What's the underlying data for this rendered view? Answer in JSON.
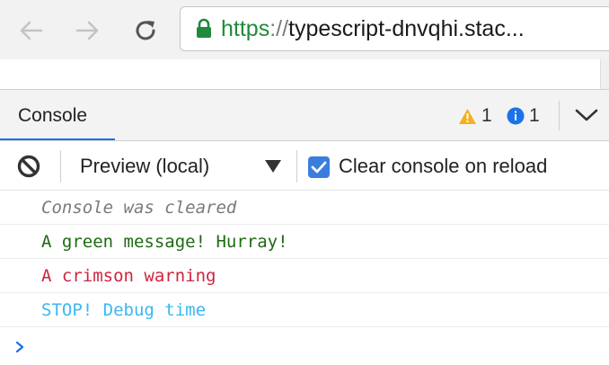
{
  "browser": {
    "url_scheme": "https",
    "url_separator": "://",
    "url_rest": "typescript-dnvqhi.stac..."
  },
  "drawer": {
    "tab_label": "Console",
    "warning_count": "1",
    "info_count": "1"
  },
  "console_toolbar": {
    "context_label": "Preview (local)",
    "clear_on_reload_label": "Clear console on reload",
    "clear_on_reload_checked": true
  },
  "messages": [
    {
      "text": "Console was cleared",
      "color": "#7a7a7a",
      "italic": true
    },
    {
      "text": "A green message! Hurray!",
      "color": "#1e6a12",
      "italic": false
    },
    {
      "text": "A crimson warning",
      "color": "#d0233e",
      "italic": false
    },
    {
      "text": "STOP! Debug time",
      "color": "#3bb7f2",
      "italic": false
    }
  ],
  "colors": {
    "accent": "#1a73e8",
    "secure_green": "#1f8a3b",
    "warning_yellow": "#f2b21b",
    "info_blue": "#1a73e8",
    "checkbox_blue": "#3b7ddd"
  },
  "icons": [
    "back-arrow-icon",
    "forward-arrow-icon",
    "reload-icon",
    "lock-icon",
    "warning-icon",
    "info-icon",
    "chevron-down-icon",
    "clear-console-icon",
    "dropdown-triangle-icon",
    "checkmark-icon",
    "prompt-chevron-icon"
  ]
}
